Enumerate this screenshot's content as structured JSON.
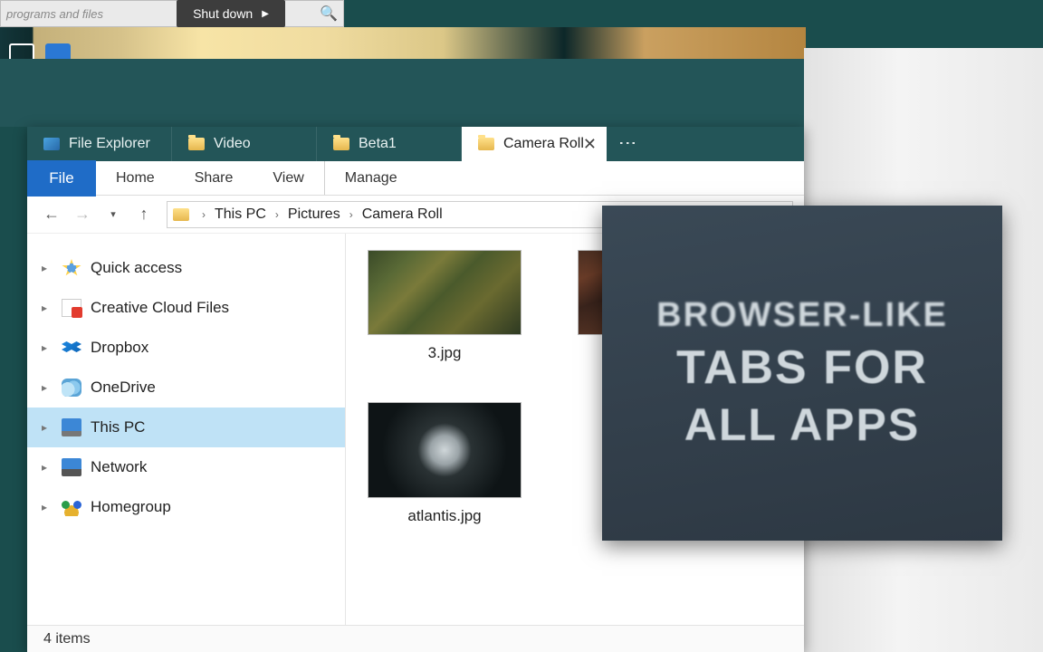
{
  "os": {
    "search_placeholder": "programs and files",
    "shutdown_label": "Shut down"
  },
  "tabs": [
    {
      "label": "File Explorer"
    },
    {
      "label": "Video"
    },
    {
      "label": "Beta1"
    },
    {
      "label": "Camera Roll"
    }
  ],
  "active_tab_index": 3,
  "file_menu": "File",
  "ribbon": [
    "Home",
    "Share",
    "View",
    "Manage"
  ],
  "breadcrumb": [
    "This PC",
    "Pictures",
    "Camera Roll"
  ],
  "sidebar": [
    {
      "label": "Quick access"
    },
    {
      "label": "Creative Cloud Files"
    },
    {
      "label": "Dropbox"
    },
    {
      "label": "OneDrive"
    },
    {
      "label": "This PC"
    },
    {
      "label": "Network"
    },
    {
      "label": "Homegroup"
    }
  ],
  "sidebar_selected_index": 4,
  "files": [
    {
      "name": "3.jpg"
    },
    {
      "name": "atlantis.jpg"
    }
  ],
  "status_text": "4 items",
  "promo": {
    "line1": "BROWSER-LIKE",
    "line2": "TABS FOR",
    "line3": "ALL APPS"
  }
}
